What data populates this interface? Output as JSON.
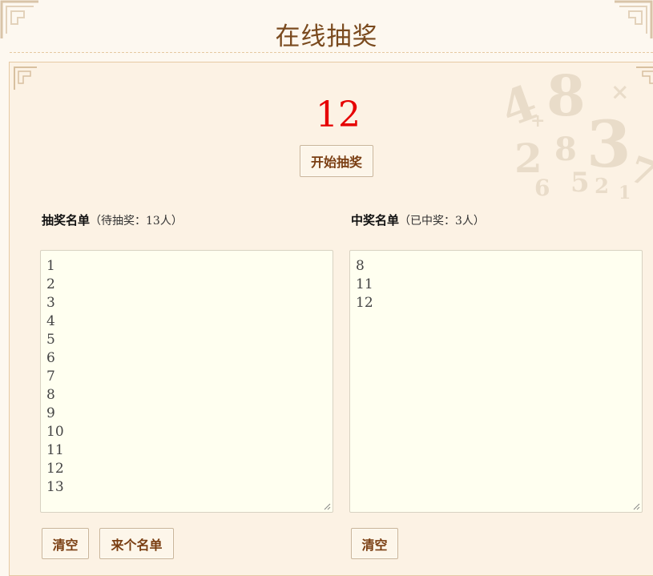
{
  "header": {
    "title": "在线抽奖"
  },
  "draw": {
    "current_number": "12",
    "start_label": "开始抽奖"
  },
  "pool": {
    "title": "抽奖名单",
    "count_text": "（待抽奖：13人）",
    "entries": [
      "1",
      "2",
      "3",
      "4",
      "5",
      "6",
      "7",
      "8",
      "9",
      "10",
      "11",
      "12",
      "13"
    ],
    "clear_label": "清空",
    "load_label": "来个名单"
  },
  "winners": {
    "title": "中奖名单",
    "count_text": "（已中奖：3人）",
    "entries": [
      "8",
      "11",
      "12"
    ],
    "clear_label": "清空"
  },
  "colors": {
    "title": "#7a4a1e",
    "number": "#e60000",
    "button_text": "#7a3e12",
    "panel_bg": "#fcf2e4",
    "list_bg": "#fffff0"
  }
}
